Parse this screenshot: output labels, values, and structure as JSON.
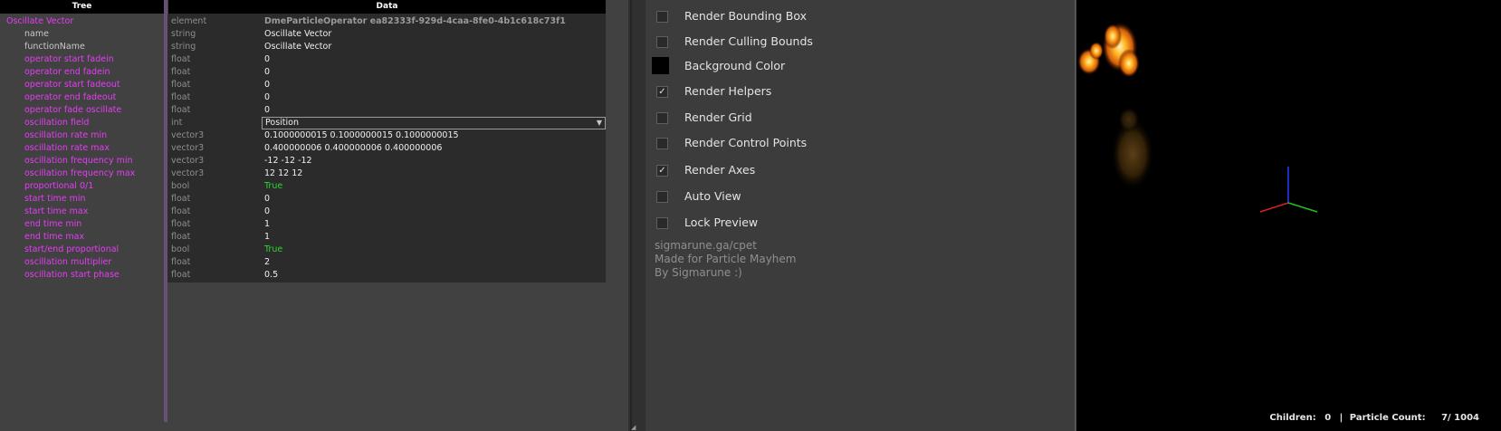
{
  "tree_header": "Tree",
  "data_header": "Data",
  "rows": [
    {
      "name": "Oscillate Vector",
      "type": "element",
      "value": "DmeParticleOperator ea82333f-929d-4caa-8fe0-4b1c618c73f1",
      "kind": "root"
    },
    {
      "name": "name",
      "type": "string",
      "value": "Oscillate Vector",
      "kind": "plain"
    },
    {
      "name": "functionName",
      "type": "string",
      "value": "Oscillate Vector",
      "kind": "plain"
    },
    {
      "name": "operator start fadein",
      "type": "float",
      "value": "0"
    },
    {
      "name": "operator end fadein",
      "type": "float",
      "value": "0"
    },
    {
      "name": "operator start fadeout",
      "type": "float",
      "value": "0"
    },
    {
      "name": "operator end fadeout",
      "type": "float",
      "value": "0"
    },
    {
      "name": "operator fade oscillate",
      "type": "float",
      "value": "0"
    },
    {
      "name": "oscillation field",
      "type": "int",
      "value": "Position",
      "kind": "dropdown"
    },
    {
      "name": "oscillation rate min",
      "type": "vector3",
      "value": "0.1000000015 0.1000000015 0.1000000015"
    },
    {
      "name": "oscillation rate max",
      "type": "vector3",
      "value": "0.400000006 0.400000006 0.400000006"
    },
    {
      "name": "oscillation frequency min",
      "type": "vector3",
      "value": "-12 -12 -12"
    },
    {
      "name": "oscillation frequency max",
      "type": "vector3",
      "value": "12 12 12"
    },
    {
      "name": "proportional 0/1",
      "type": "bool",
      "value": "True",
      "kind": "bool"
    },
    {
      "name": "start time min",
      "type": "float",
      "value": "0"
    },
    {
      "name": "start time max",
      "type": "float",
      "value": "0"
    },
    {
      "name": "end time min",
      "type": "float",
      "value": "1"
    },
    {
      "name": "end time max",
      "type": "float",
      "value": "1"
    },
    {
      "name": "start/end proportional",
      "type": "bool",
      "value": "True",
      "kind": "bool"
    },
    {
      "name": "oscillation multiplier",
      "type": "float",
      "value": "2"
    },
    {
      "name": "oscillation start phase",
      "type": "float",
      "value": "0.5"
    }
  ],
  "options": [
    {
      "label": "Render Bounding Box",
      "checked": false
    },
    {
      "label": "Render Culling Bounds",
      "checked": false
    },
    {
      "label": "Background Color",
      "kind": "color",
      "color": "#000000"
    },
    {
      "label": "Render Helpers",
      "checked": true
    },
    {
      "label": "Render Grid",
      "checked": false
    },
    {
      "label": "Render Control Points",
      "checked": false
    },
    {
      "label": "Render Axes",
      "checked": true
    },
    {
      "label": "Auto View",
      "checked": false
    },
    {
      "label": "Lock Preview",
      "checked": false
    }
  ],
  "credits": [
    "sigmarune.ga/cpet",
    "Made for Particle Mayhem",
    "By Sigmarune :)"
  ],
  "viewport": {
    "children_label": "Children:",
    "children_value": "0",
    "separator": "|",
    "particle_label": "Particle Count:",
    "particle_value": "7/ 1004",
    "axis_colors": {
      "x": "#e02020",
      "y": "#20c020",
      "z": "#2040ff"
    }
  },
  "colors": {
    "accent": "#e43ef3",
    "bool_true": "#2fd42f"
  }
}
